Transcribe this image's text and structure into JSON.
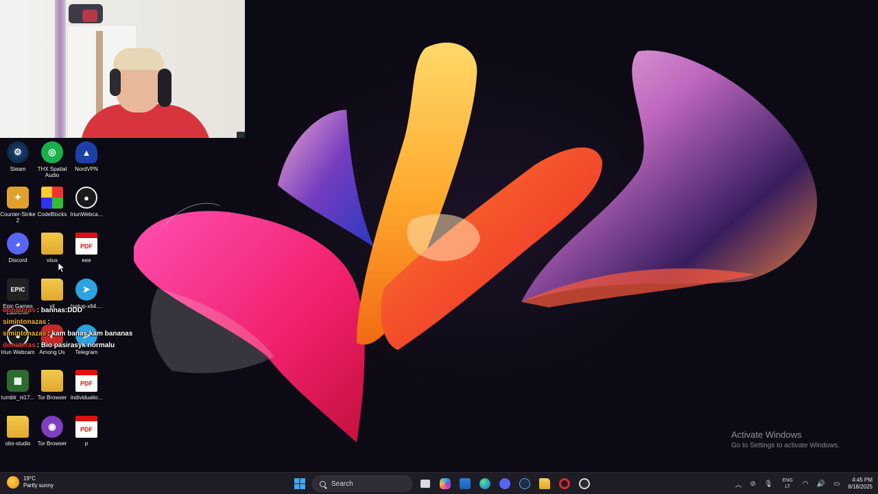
{
  "desktop": {
    "icons": [
      {
        "label": "Steam",
        "icon": "steam-icon"
      },
      {
        "label": "THX Spatial Audio",
        "icon": "thx-icon"
      },
      {
        "label": "NordVPN",
        "icon": "nordvpn-icon"
      },
      {
        "label": "Counter-Strike 2",
        "icon": "counter-strike-icon"
      },
      {
        "label": "CodeBlocks",
        "icon": "codeblocks-icon"
      },
      {
        "label": "IriunWebca...",
        "icon": "iriun-webcam-icon"
      },
      {
        "label": "Discord",
        "icon": "discord-icon"
      },
      {
        "label": "viius",
        "icon": "folder-icon"
      },
      {
        "label": "eee",
        "icon": "pdf-icon"
      },
      {
        "label": "Epic Games Launcher",
        "icon": "epic-games-icon"
      },
      {
        "label": "vil",
        "icon": "folder-icon"
      },
      {
        "label": "tsetup-x64....",
        "icon": "telegram-setup-icon"
      },
      {
        "label": "Iriun Webcam",
        "icon": "iriun-webcam-icon"
      },
      {
        "label": "Among Us",
        "icon": "among-us-icon"
      },
      {
        "label": "Telegram",
        "icon": "telegram-icon"
      },
      {
        "label": "tumblr_ni17...",
        "icon": "image-file-icon"
      },
      {
        "label": "Tor Browser",
        "icon": "folder-icon"
      },
      {
        "label": "individualio...",
        "icon": "pdf-icon"
      },
      {
        "label": "obs-studio",
        "icon": "folder-icon"
      },
      {
        "label": "Tor Browser",
        "icon": "tor-browser-icon"
      },
      {
        "label": "p",
        "icon": "pdf-icon"
      }
    ]
  },
  "chat": [
    {
      "user": "donateras",
      "message": ": bannas:DDD",
      "color": "#e53935"
    },
    {
      "user": "simintonazas",
      "message": ": ",
      "color": "#f2b632"
    },
    {
      "user": "simintonazas",
      "message": ": kam banas kam bananas",
      "color": "#f2b632"
    },
    {
      "user": "donateras",
      "message": ": Bio pasirasyk normalu",
      "color": "#e53935"
    }
  ],
  "watermark": {
    "title": "Activate Windows",
    "subtitle": "Go to Settings to activate Windows."
  },
  "taskbar": {
    "weather": {
      "temp": "19°C",
      "condition": "Partly sunny"
    },
    "search_placeholder": "Search",
    "apps": [
      "start-icon",
      "task-view-icon",
      "copilot-icon",
      "store-icon",
      "edge-icon",
      "discord-icon",
      "steam-icon",
      "file-explorer-icon",
      "opera-icon",
      "obs-icon"
    ],
    "tray": {
      "language": "ENG",
      "region": "LT",
      "time": "4:45 PM",
      "date": "8/18/2025"
    }
  },
  "colors": {
    "taskbar_bg": "#1e1c24",
    "wallpaper_bg": "#0c0a14",
    "chat_red": "#e53935",
    "chat_yellow": "#f2b632"
  }
}
